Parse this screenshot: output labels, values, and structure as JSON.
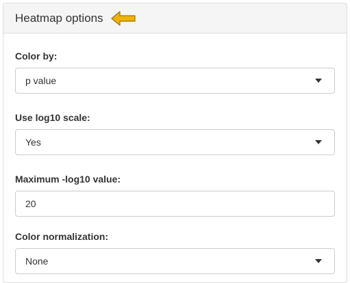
{
  "panel": {
    "title": "Heatmap options",
    "arrow_icon": "left-arrow-icon",
    "arrow_color": "#f0b400"
  },
  "fields": {
    "color_by": {
      "label": "Color by:",
      "value": "p value"
    },
    "log10": {
      "label": "Use log10 scale:",
      "value": "Yes"
    },
    "max_log10": {
      "label": "Maximum -log10 value:",
      "value": "20"
    },
    "normalization": {
      "label": "Color normalization:",
      "value": "None"
    }
  }
}
